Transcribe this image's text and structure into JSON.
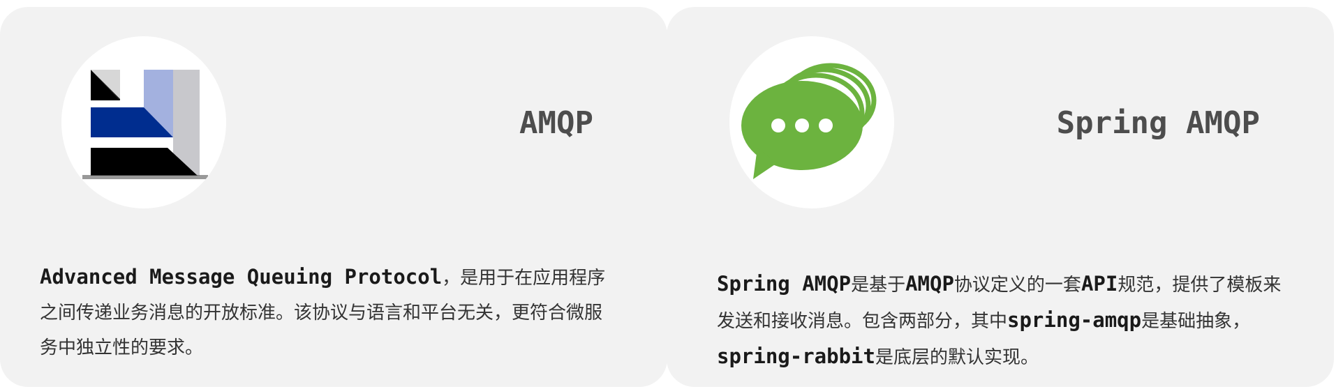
{
  "cards": [
    {
      "title": "AMQP",
      "icon": "amqp-logo-icon",
      "desc_segments": [
        {
          "text": "Advanced Message Queuing Protocol",
          "kw": true
        },
        {
          "text": "，是用于在应用程序之间传递业务消息的开放标准。该协议与语言和平台无关，更符合微服务中独立性的要求。",
          "kw": false
        }
      ]
    },
    {
      "title": "Spring AMQP",
      "icon": "chat-bubble-icon",
      "desc_segments": [
        {
          "text": "Spring AMQP",
          "kw": true
        },
        {
          "text": "是基于",
          "kw": false
        },
        {
          "text": "AMQP",
          "kw": true
        },
        {
          "text": "协议定义的一套",
          "kw": false
        },
        {
          "text": "API",
          "kw": true
        },
        {
          "text": "规范，提供了模板来发送和接收消息。包含两部分，其中",
          "kw": false
        },
        {
          "text": "spring-amqp",
          "kw": true
        },
        {
          "text": "是基础抽象，",
          "kw": false
        },
        {
          "text": "spring-rabbit",
          "kw": true
        },
        {
          "text": "是底层的默认实现。",
          "kw": false
        }
      ]
    }
  ],
  "colors": {
    "card_bg": "#f2f2f2",
    "title": "#4d4d4d",
    "text": "#333333",
    "amqp_blue": "#002d8f",
    "amqp_light_blue": "#a3b1df",
    "amqp_gray": "#c8c8cc",
    "chat_green": "#6cb33f"
  }
}
